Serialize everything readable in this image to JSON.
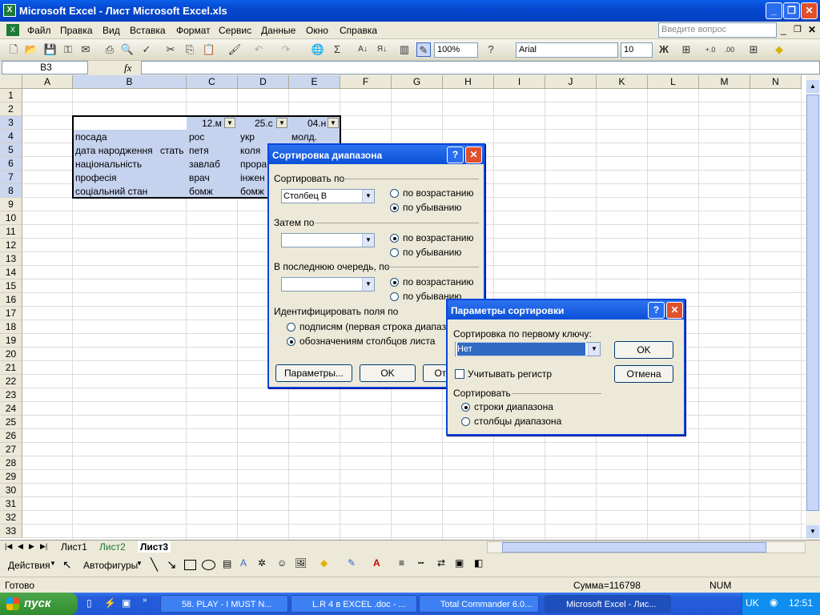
{
  "window": {
    "title": "Microsoft Excel - Лист Microsoft Excel.xls"
  },
  "menu": [
    "Файл",
    "Правка",
    "Вид",
    "Вставка",
    "Формат",
    "Сервис",
    "Данные",
    "Окно",
    "Справка"
  ],
  "help_placeholder": "Введите вопрос",
  "toolbar": {
    "zoom": "100%",
    "font": "Arial",
    "size": "10",
    "bold": "Ж"
  },
  "formula": {
    "namebox": "B3",
    "fx": "fx"
  },
  "columns": [
    "A",
    "B",
    "C",
    "D",
    "E",
    "F",
    "G",
    "H",
    "I",
    "J",
    "K",
    "L",
    "M",
    "N"
  ],
  "rows": [
    "1",
    "2",
    "3",
    "4",
    "5",
    "6",
    "7",
    "8",
    "9",
    "10",
    "11",
    "12",
    "13",
    "14",
    "15",
    "16",
    "17",
    "18",
    "19",
    "20",
    "21",
    "22",
    "23",
    "24",
    "25",
    "26",
    "27",
    "28",
    "29",
    "30",
    "31",
    "32",
    "33"
  ],
  "cells": {
    "c3": "12.м",
    "d3": "25.с",
    "e3": "04.н",
    "b4": "посада",
    "c4": "рос",
    "d4": "укр",
    "e4": "молд.",
    "b5": "дата народження",
    "b5b": "стать",
    "c5": "петя",
    "d5": "коля",
    "b6": "національність",
    "c6": "завлаб",
    "d6": "прора",
    "b7": "професія",
    "c7": "врач",
    "d7": "інжен",
    "b8": "соціальний стан",
    "c8": "бомж",
    "d8": "бомж"
  },
  "sortdlg": {
    "title": "Сортировка диапазона",
    "sortby": "Сортировать по",
    "sortby_value": "Столбец B",
    "asc": "по возрастанию",
    "desc": "по убыванию",
    "then": "Затем по",
    "last": "В последнюю очередь, по",
    "identify": "Идентифицировать поля по",
    "opt_headers": "подписям (первая строка диапазона)",
    "opt_colnames": "обозначениям столбцов листа",
    "params": "Параметры...",
    "ok": "OK",
    "cancel": "Отмена"
  },
  "optdlg": {
    "title": "Параметры сортировки",
    "firstkey": "Сортировка по первому ключу:",
    "firstkey_value": "Нет",
    "ok": "OK",
    "cancel": "Отмена",
    "casesens": "Учитывать регистр",
    "sort": "Сортировать",
    "rows": "строки диапазона",
    "cols": "столбцы диапазона"
  },
  "sheets": [
    "Лист1",
    "Лист2",
    "Лист3"
  ],
  "drawbar": {
    "actions": "Действия",
    "autoshapes": "Автофигуры"
  },
  "status": {
    "ready": "Готово",
    "sum": "Сумма=116798",
    "num": "NUM"
  },
  "taskbar": {
    "start": "пуск",
    "tasks": [
      "58. PLAY - I MUST N...",
      "L.R 4 в EXCEL .doc - ...",
      "Total Commander 6.0...",
      "Microsoft Excel - Лис..."
    ],
    "lang": "UK",
    "time": "12:51"
  }
}
